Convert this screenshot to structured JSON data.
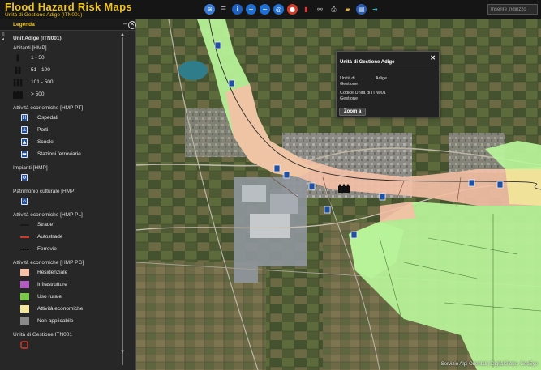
{
  "header": {
    "title": "Flood Hazard Risk Maps",
    "subtitle": "Unità di Gestione Adige (ITN001)",
    "search_placeholder": "Inserire indirizzo"
  },
  "toolbar": {
    "icons": [
      "layers-icon",
      "list-icon",
      "info-icon",
      "zoom-in-icon",
      "zoom-out-icon",
      "zoom-extent-icon",
      "stop-icon",
      "book-icon",
      "binoculars-icon",
      "print-icon",
      "folder-icon",
      "stats-icon",
      "share-icon"
    ]
  },
  "legend": {
    "panel_label": "Legenda",
    "title": "Unit Adige (ITN001)",
    "abitanti": {
      "heading": "Abitanti [HMP]",
      "items": [
        "1 - 50",
        "51 - 100",
        "101 - 500",
        "> 500"
      ]
    },
    "pt": {
      "heading": "Attività economiche [HMP PT]",
      "items": [
        "Ospedali",
        "Porti",
        "Scuole",
        "Stazioni ferroviarie"
      ]
    },
    "impianti": {
      "heading": "Impianti [HMP]"
    },
    "patrimonio": {
      "heading": "Patrimonio culturale [HMP]"
    },
    "pl": {
      "heading": "Attività economiche [HMP PL]",
      "items": [
        "Strade",
        "Autostrade",
        "Ferrovie"
      ]
    },
    "pg": {
      "heading": "Attività economiche [HMP PG]",
      "items": [
        "Residenziale",
        "Infrastrutture",
        "Uso rurale",
        "Attività economiche",
        "Non applicabile"
      ]
    },
    "ug": {
      "heading": "Unità di Gestione ITN001"
    }
  },
  "popup": {
    "title": "Unità di Gestione Adige",
    "key1": "Unità di Gestione",
    "val1": "Adige",
    "key2": "Codice Unità di ITN001 Gestione",
    "zoom_label": "Zoom a"
  },
  "map": {
    "attribution": "Servizio Alpi Orientali | DigitalGlobe, GeoEye"
  },
  "colors": {
    "accent": "#f0c419",
    "flood_green": "#b8f59a",
    "residential": "#f5c0a6",
    "economic": "#f2e79a",
    "infrastructure": "#b35cc4",
    "rural": "#7ac94a",
    "non_applicable": "#8a8a8a",
    "poi_blue": "#1f4fa3"
  }
}
